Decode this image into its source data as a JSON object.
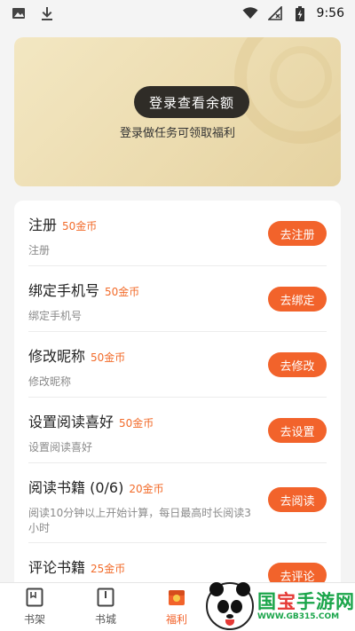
{
  "status_bar": {
    "time": "9:56",
    "left_icons": [
      "image-icon",
      "download-icon"
    ],
    "right_icons": [
      "wifi-icon",
      "no-signal-icon",
      "battery-charging-icon"
    ]
  },
  "balance_card": {
    "login_button": "登录查看余额",
    "subtitle": "登录做任务可领取福利"
  },
  "tasks": [
    {
      "title": "注册",
      "reward": "50金币",
      "desc": "注册",
      "action": "去注册"
    },
    {
      "title": "绑定手机号",
      "reward": "50金币",
      "desc": "绑定手机号",
      "action": "去绑定"
    },
    {
      "title": "修改昵称",
      "reward": "50金币",
      "desc": "修改昵称",
      "action": "去修改"
    },
    {
      "title": "设置阅读喜好",
      "reward": "50金币",
      "desc": "设置阅读喜好",
      "action": "去设置"
    },
    {
      "title": "阅读书籍 (0/6)",
      "reward": "20金币",
      "desc": "阅读10分钟以上开始计算，每日最高时长阅读3小时",
      "action": "去阅读"
    },
    {
      "title": "评论书籍",
      "reward": "25金币",
      "desc": "",
      "action": "去评论"
    }
  ],
  "tab_bar": {
    "tabs": [
      {
        "label": "书架",
        "icon": "bookshelf-icon",
        "active": false
      },
      {
        "label": "书城",
        "icon": "bookstore-icon",
        "active": false
      },
      {
        "label": "福利",
        "icon": "welfare-icon",
        "active": true
      }
    ]
  },
  "watermark": {
    "brand_prefix": "国",
    "brand_red": "宝",
    "brand_suffix": "手游网",
    "url": "WWW.GB315.COM"
  },
  "colors": {
    "accent": "#f2632b",
    "reward": "#f26b2a",
    "login_button_bg": "#2f2c27",
    "card_gold": "#ecdcb0"
  }
}
